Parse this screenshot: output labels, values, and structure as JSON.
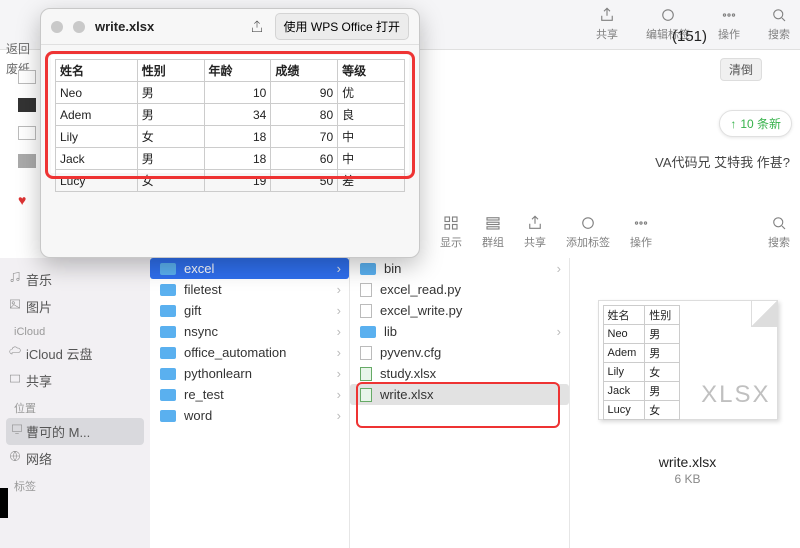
{
  "quicklook": {
    "title": "write.xlsx",
    "open_with_label": "使用 WPS Office 打开",
    "headers": [
      "姓名",
      "性别",
      "年龄",
      "成绩",
      "等级"
    ],
    "rows": [
      {
        "name": "Neo",
        "gender": "男",
        "age": 10,
        "score": 90,
        "grade": "优"
      },
      {
        "name": "Adem",
        "gender": "男",
        "age": 34,
        "score": 80,
        "grade": "良"
      },
      {
        "name": "Lily",
        "gender": "女",
        "age": 18,
        "score": 70,
        "grade": "中"
      },
      {
        "name": "Jack",
        "gender": "男",
        "age": 18,
        "score": 60,
        "grade": "中"
      },
      {
        "name": "Lucy",
        "gender": "女",
        "age": 19,
        "score": 50,
        "grade": "差"
      }
    ]
  },
  "topbar_back_label": "返回",
  "sidebar_trash_label": "废纸",
  "chat": {
    "title_suffix": "(151)",
    "clear_btn": "清倒",
    "new_msgs": "10 条新",
    "line_fragment": "VA代码兄 艾特我 作甚?"
  },
  "finder": {
    "path_fragment": "ﾉ,,,,,",
    "toolbar": {
      "display": "显示",
      "group": "群组",
      "share": "共享",
      "tag": "添加标签",
      "action": "操作",
      "search": "搜索"
    },
    "toolbar_faded": {
      "share": "共享",
      "edit_tag": "编辑标签",
      "action": "操作",
      "search": "搜索"
    },
    "sidebar": {
      "music": "音乐",
      "pictures": "图片",
      "icloud_header": "iCloud",
      "icloud_drive": "iCloud 云盘",
      "shared": "共享",
      "locations_header": "位置",
      "mac": "曹可的 M...",
      "network": "网络",
      "tags_header": "标签"
    },
    "folders": [
      {
        "name": "excel",
        "selected": true
      },
      {
        "name": "filetest"
      },
      {
        "name": "gift"
      },
      {
        "name": "nsync"
      },
      {
        "name": "office_automation"
      },
      {
        "name": "pythonlearn"
      },
      {
        "name": "re_test"
      },
      {
        "name": "word"
      }
    ],
    "files": [
      {
        "name": "bin",
        "type": "folder"
      },
      {
        "name": "excel_read.py",
        "type": "file"
      },
      {
        "name": "excel_write.py",
        "type": "file"
      },
      {
        "name": "lib",
        "type": "folder"
      },
      {
        "name": "pyvenv.cfg",
        "type": "file"
      },
      {
        "name": "study.xlsx",
        "type": "xlsx"
      },
      {
        "name": "write.xlsx",
        "type": "xlsx",
        "selected": true
      }
    ],
    "preview": {
      "filename": "write.xlsx",
      "size": "6 KB",
      "watermark": "XLSX",
      "thumb_headers": [
        "姓名",
        "性别"
      ],
      "thumb_rows": [
        {
          "c1": "Neo",
          "c2": "男"
        },
        {
          "c1": "Adem",
          "c2": "男"
        },
        {
          "c1": "Lily",
          "c2": "女"
        },
        {
          "c1": "Jack",
          "c2": "男"
        },
        {
          "c1": "Lucy",
          "c2": "女"
        }
      ]
    }
  },
  "chart_data": {
    "type": "table",
    "title": "write.xlsx",
    "columns": [
      "姓名",
      "性别",
      "年龄",
      "成绩",
      "等级"
    ],
    "rows": [
      [
        "Neo",
        "男",
        10,
        90,
        "优"
      ],
      [
        "Adem",
        "男",
        34,
        80,
        "良"
      ],
      [
        "Lily",
        "女",
        18,
        70,
        "中"
      ],
      [
        "Jack",
        "男",
        18,
        60,
        "中"
      ],
      [
        "Lucy",
        "女",
        19,
        50,
        "差"
      ]
    ]
  }
}
